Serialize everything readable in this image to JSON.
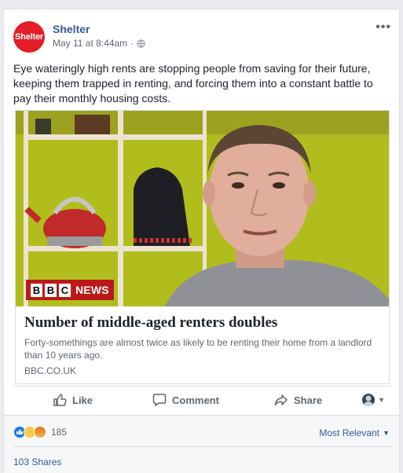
{
  "post": {
    "page_name": "Shelter",
    "avatar_label": "Shelter",
    "date": "May 11 at 8:44am",
    "separator": "·",
    "more_label": "•••",
    "text": "Eye wateringly high rents are stopping people from saving for their future, keeping them trapped in renting, and forcing them into a constant battle to pay their monthly housing costs."
  },
  "link": {
    "badge_box": [
      "B",
      "B",
      "C"
    ],
    "badge_label": "NEWS",
    "title": "Number of middle-aged renters doubles",
    "description": "Forty-somethings are almost twice as likely to be renting their home from a landlord than 10 years ago.",
    "domain": "BBC.CO.UK"
  },
  "actions": {
    "like_label": "Like",
    "comment_label": "Comment",
    "share_label": "Share",
    "caret": "▼"
  },
  "footer": {
    "reaction_count": "185",
    "sort_label": "Most Relevant",
    "sort_caret": "▼",
    "shares_label": "103 Shares"
  },
  "colors": {
    "brand": "#e31e26",
    "link": "#365899",
    "bbc_red": "#bb1919"
  },
  "icons": [
    "globe-icon",
    "more-icon",
    "like-icon",
    "comment-icon",
    "share-icon",
    "caret-icon",
    "like-reaction-icon",
    "sad-reaction-icon",
    "angry-reaction-icon"
  ]
}
